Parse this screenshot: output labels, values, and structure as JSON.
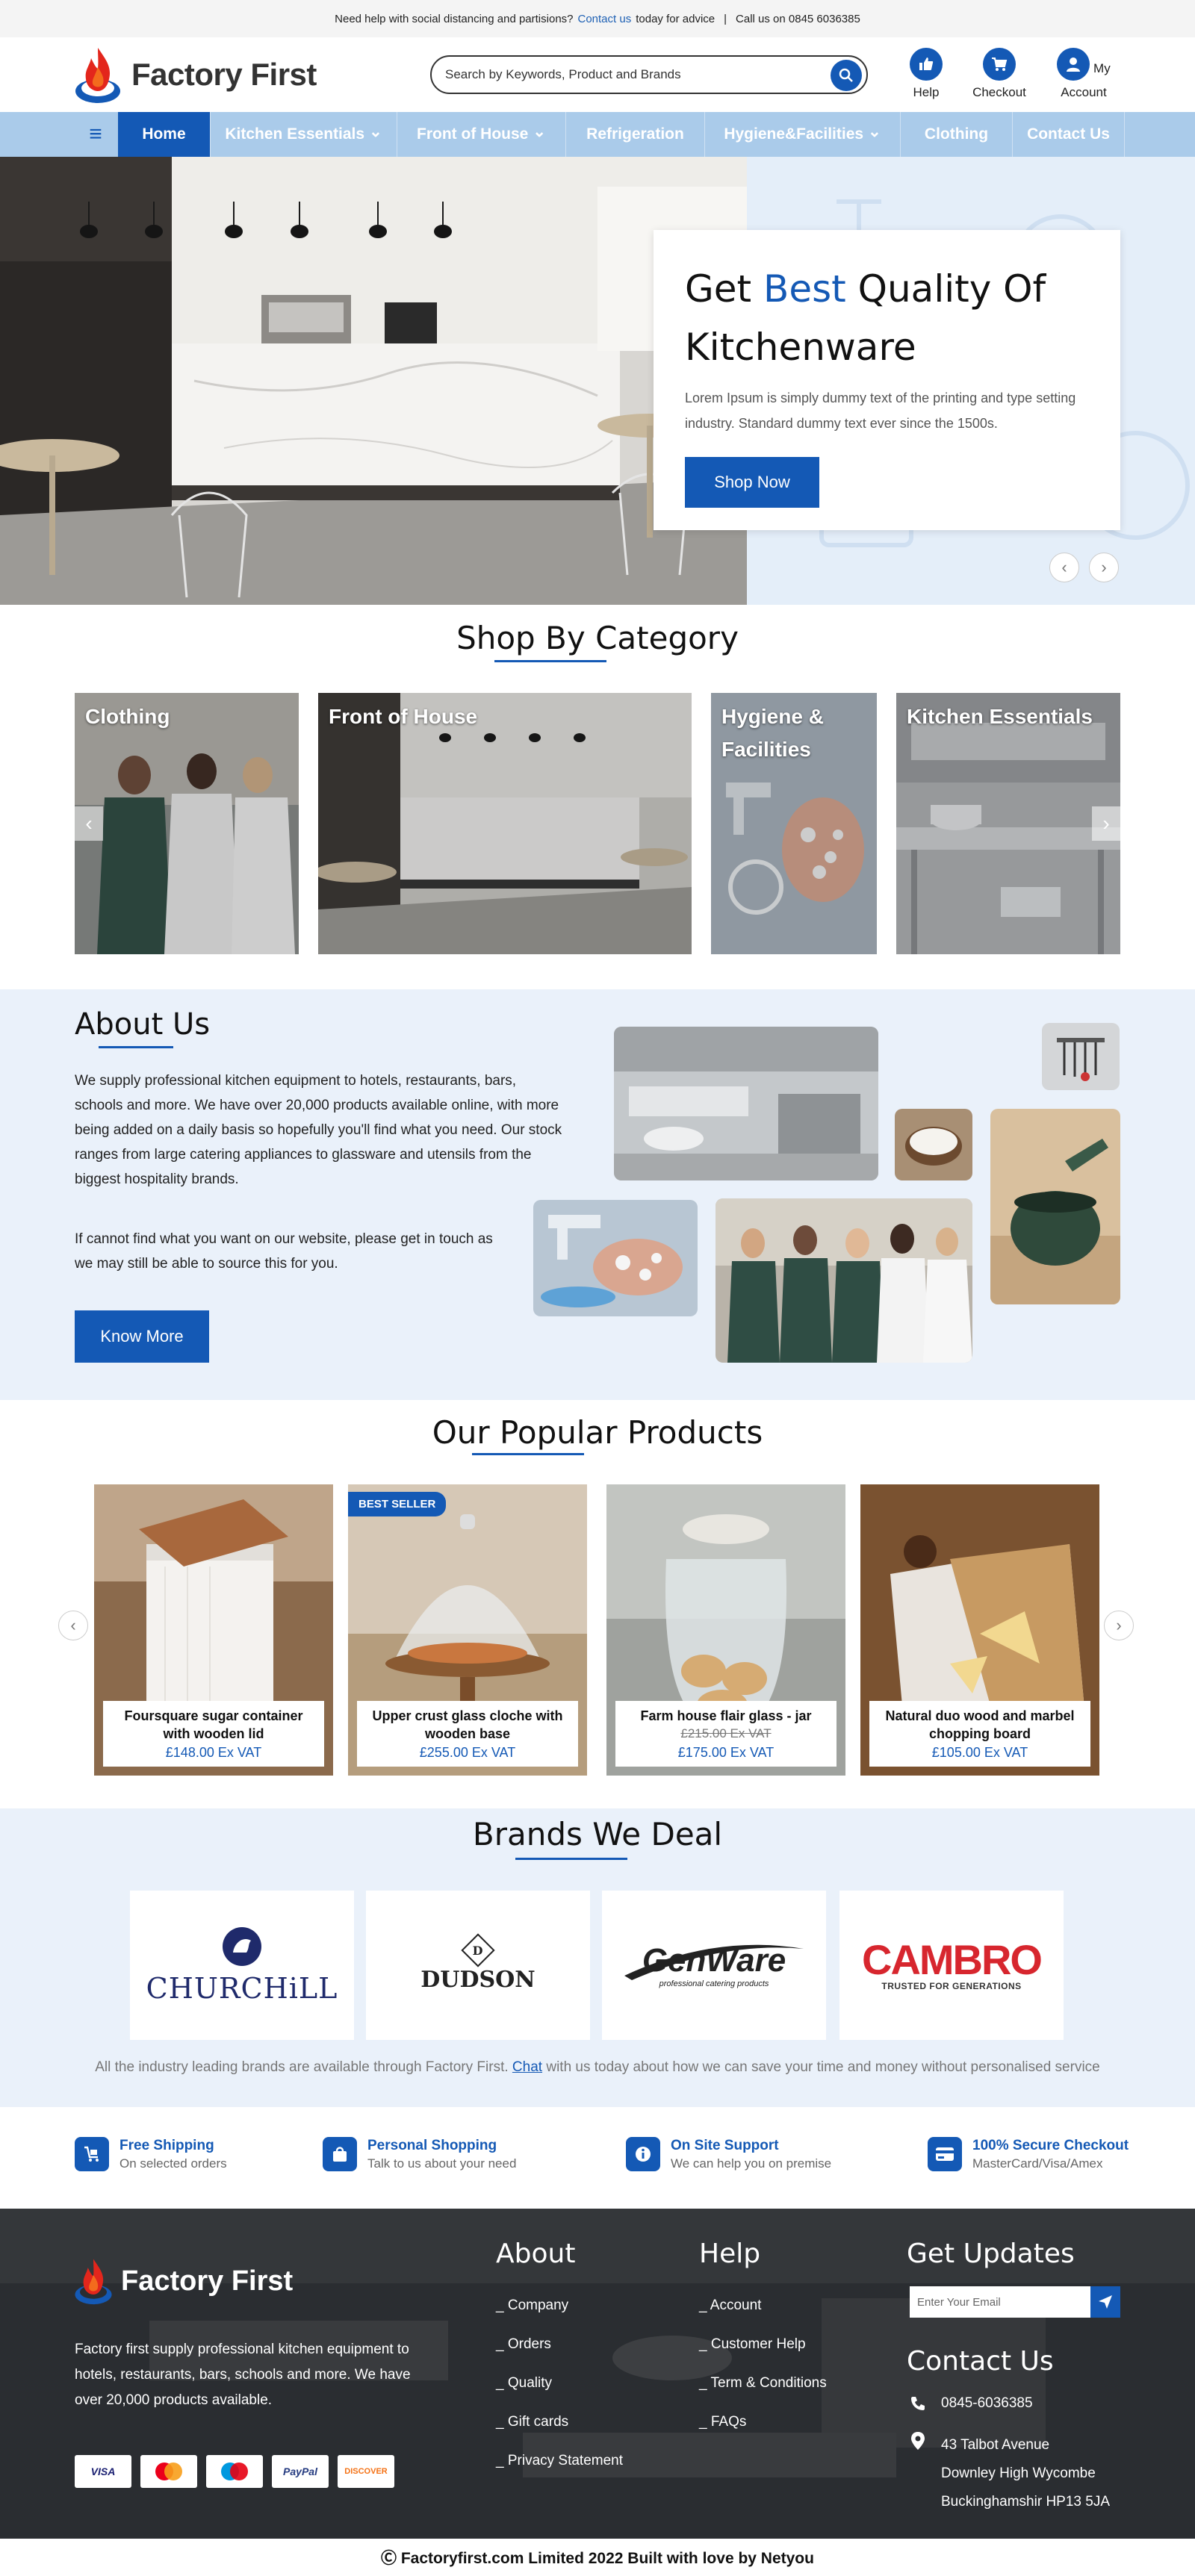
{
  "topbar": {
    "help_text": "Need help with social distancing and  partisions?",
    "contact_link": "Contact us",
    "advice_text": "today for advice",
    "separator": "|",
    "phone_text": "Call us on 0845 6036385"
  },
  "header": {
    "logo_text": "Factory First",
    "search_placeholder": "Search by Keywords, Product and Brands",
    "icons": [
      {
        "label": "Help",
        "icon": "thumbs-up-icon"
      },
      {
        "label": "Checkout",
        "icon": "cart-icon"
      },
      {
        "label": "My Account",
        "icon": "user-icon"
      }
    ]
  },
  "nav": {
    "menu_icon": "≡",
    "items": [
      "Home",
      "Kitchen Essentials",
      "Front of House",
      "Refrigeration",
      "Hygiene&Facilities",
      "Clothing",
      "Contact Us"
    ],
    "dropdown_caret": "⌄"
  },
  "hero": {
    "title_pre": "Get ",
    "title_highlight": "Best",
    "title_post": " Quality Of Kitchenware",
    "description": "Lorem Ipsum is simply dummy text of the printing and type setting industry. Standard dummy text ever since the 1500s.",
    "button": "Shop Now",
    "prev": "‹",
    "next": "›"
  },
  "categories": {
    "title": "Shop By Category",
    "items": [
      "Clothing",
      "Front of House",
      "Hygiene & Facilities",
      "Kitchen Essentials"
    ],
    "prev": "‹",
    "next": "›"
  },
  "about": {
    "title": "About Us",
    "paragraph1": "We supply professional kitchen equipment to hotels, restaurants, bars, schools and more. We have over 20,000 products available online, with more being added on a daily basis so hopefully you'll find what you need. Our stock ranges from large catering appliances  to glassware and utensils from the biggest hospitality brands.",
    "paragraph2": "If cannot find what you want on our website, please get in touch as we may still be able to source this for you.",
    "button": "Know More"
  },
  "products": {
    "title": "Our Popular Products",
    "badge": "BEST SELLER",
    "items": [
      {
        "name": "Foursquare sugar container with wooden lid",
        "old_price": "",
        "price": "£148.00 Ex VAT"
      },
      {
        "name": "Upper crust glass cloche with wooden base",
        "old_price": "",
        "price": "£255.00 Ex VAT"
      },
      {
        "name": "Farm house flair glass - jar",
        "old_price": "£215.00 Ex VAT",
        "price": "£175.00 Ex VAT"
      },
      {
        "name": "Natural duo wood and marbel chopping board",
        "old_price": "",
        "price": "£105.00 Ex VAT"
      }
    ],
    "prev": "‹",
    "next": "›"
  },
  "brands": {
    "title": "Brands We Deal",
    "logos": [
      {
        "name": "CHURCHiLL"
      },
      {
        "name": "DUDSON",
        "mark": "D"
      },
      {
        "name": "GenWare",
        "tagline": "professional catering products"
      },
      {
        "name": "CAMBRO",
        "tagline": "TRUSTED FOR GENERATIONS"
      }
    ],
    "note_pre": "All the industry leading brands are available through Factory First. ",
    "note_link": "Chat",
    "note_post": " with us today about how we can save your time and money without personalised service"
  },
  "features": [
    {
      "title": "Free Shipping",
      "subtitle": "On selected orders",
      "icon": "trolley-icon"
    },
    {
      "title": "Personal Shopping",
      "subtitle": "Talk to us about your need",
      "icon": "shopping-bag-icon"
    },
    {
      "title": "On Site Support",
      "subtitle": "We can help you on premise",
      "icon": "info-icon"
    },
    {
      "title": "100% Secure Checkout",
      "subtitle": "MasterCard/Visa/Amex",
      "icon": "credit-card-icon"
    }
  ],
  "footer": {
    "logo_text": "Factory First",
    "description": "Factory first supply professional kitchen equipment to hotels, restaurants, bars, schools and more. We have over 20,000 products available.",
    "payments": [
      "VISA",
      "MasterCard",
      "Maestro",
      "PayPal",
      "DISCOVER"
    ],
    "about_title": "About",
    "about_links": [
      "_ Company",
      "_ Orders",
      "_ Quality",
      "_ Gift cards",
      "_ Privacy Statement"
    ],
    "help_title": "Help",
    "help_links": [
      "_ Account",
      "_ Customer Help",
      "_ Term & Conditions",
      "_ FAQs"
    ],
    "updates_title": "Get Updates",
    "email_placeholder": "Enter Your Email",
    "contact_title": "Contact Us",
    "phone": "0845-6036385",
    "address_lines": [
      "43 Talbot Avenue",
      "Downley High Wycombe",
      "Buckinghamshir HP13 5JA"
    ]
  },
  "copyright": "Ⓒ Factoryfirst.com Limited 2022 Built with love by Netyou",
  "colors": {
    "brand": "#1459b5",
    "nav_bg": "#aacbea",
    "about_bg": "#eaf1fa",
    "footer_bg": "#2a2d31"
  }
}
